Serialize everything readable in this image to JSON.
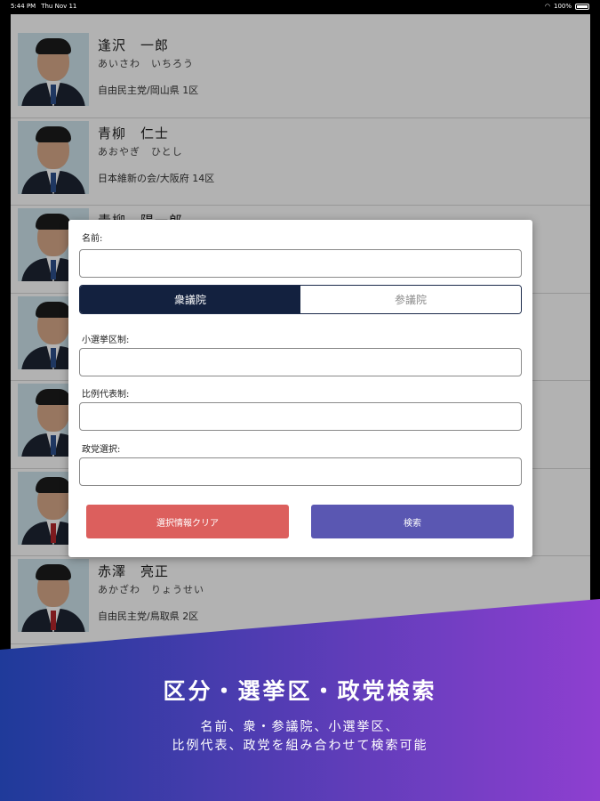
{
  "status_bar": {
    "time": "5:44 PM",
    "date": "Thu Nov 11",
    "battery": "100%"
  },
  "members": [
    {
      "name": "逢沢　一郎",
      "kana": "あいさわ　いちろう",
      "party": "自由民主党/岡山県 1区"
    },
    {
      "name": "青柳　仁士",
      "kana": "あおやぎ　ひとし",
      "party": "日本維新の会/大阪府 14区"
    },
    {
      "name": "青柳　陽一郎",
      "kana": "",
      "party": ""
    },
    {
      "name": "",
      "kana": "",
      "party": ""
    },
    {
      "name": "",
      "kana": "",
      "party": ""
    },
    {
      "name": "",
      "kana": "",
      "party": ""
    },
    {
      "name": "赤澤　亮正",
      "kana": "あかざわ　りょうせい",
      "party": "自由民主党/鳥取県 2区"
    }
  ],
  "dialog": {
    "name_label": "名前:",
    "name_value": "",
    "tab_lower": "衆議院",
    "tab_upper": "参議院",
    "district_label": "小選挙区制:",
    "district_value": "",
    "proportional_label": "比例代表制:",
    "proportional_value": "",
    "party_label": "政党選択:",
    "party_value": "",
    "clear_button": "選択情報クリア",
    "search_button": "検索"
  },
  "promo": {
    "title": "区分・選挙区・政党検索",
    "line1": "名前、衆・参議院、小選挙区、",
    "line2": "比例代表、政党を組み合わせて検索可能"
  },
  "colors": {
    "active_tab": "#13213f",
    "clear_button": "#dc5f5d",
    "search_button": "#5a57b2",
    "banner_start": "#1f3a9a",
    "banner_end": "#8e3fd0"
  }
}
